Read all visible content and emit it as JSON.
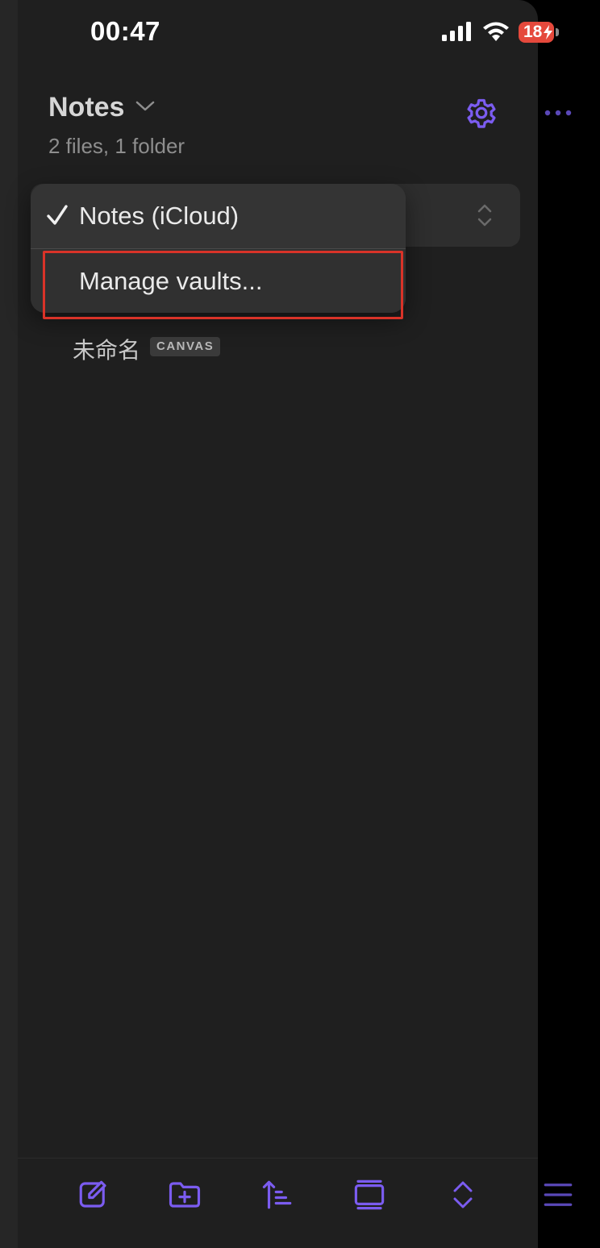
{
  "status_bar": {
    "time": "00:47",
    "battery_level": "18",
    "icons": [
      "signal-icon",
      "wifi-icon",
      "battery-charging-icon"
    ]
  },
  "header": {
    "title": "Notes",
    "subtitle": "2 files, 1 folder",
    "icons": [
      "chevron-down-icon",
      "gear-icon",
      "more-icon"
    ]
  },
  "vault_menu": {
    "items": [
      {
        "label": "Notes (iCloud)",
        "checked": true
      },
      {
        "label": "Manage vaults...",
        "checked": false
      }
    ]
  },
  "file_list": {
    "items": [
      {
        "name": "未命名",
        "badge": "CANVAS"
      }
    ]
  },
  "toolbar": {
    "icons": [
      "new-note-icon",
      "new-folder-icon",
      "sort-icon",
      "view-mode-icon",
      "expand-collapse-icon",
      "menu-icon"
    ]
  },
  "colors": {
    "accent": "#7b5cf0",
    "panel_bg": "#1f1f1f",
    "highlight": "#d93328",
    "battery": "#e5493c"
  }
}
